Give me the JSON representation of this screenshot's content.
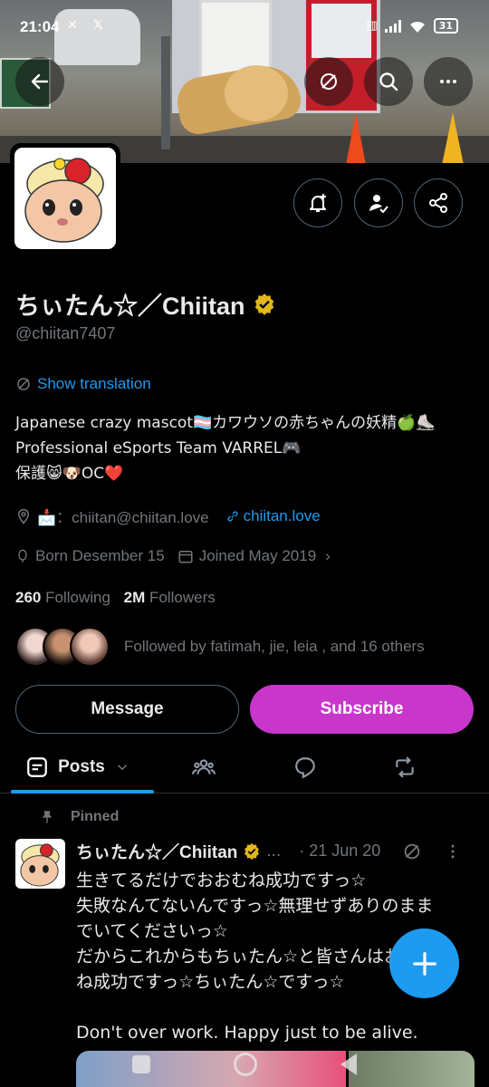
{
  "status_bar": {
    "time": "21:04",
    "notification_icons": "✕ 𝕏",
    "battery": "31"
  },
  "profile": {
    "display_name": "ちぃたん☆／Chiitan",
    "handle": "@chiitan7407",
    "show_translation": "Show translation",
    "bio_lines": [
      "Japanese crazy mascot🏳️‍⚧️カワウソの赤ちゃんの妖精🍏⛸️",
      "Professional eSports Team VARREL🎮",
      "保護😸🐶OC❤️"
    ],
    "location": "📩：chiitan@chiitan.love",
    "website": "chiitan.love",
    "birthday": "Born Desember 15",
    "joined": "Joined May 2019",
    "following_count": "260",
    "following_label": "Following",
    "followers_count": "2M",
    "followers_label": "Followers",
    "followed_by": "Followed by fatimah, jie, leia , and 16 others"
  },
  "buttons": {
    "message": "Message",
    "subscribe": "Subscribe"
  },
  "tabs": {
    "posts": "Posts"
  },
  "post": {
    "pinned_label": "Pinned",
    "author": "ちぃたん☆／Chiitan",
    "ellipsis": "...",
    "date": "· 21 Jun 20",
    "body_lines": [
      "生きてるだけでおおむね成功ですっ☆",
      "失敗なんてないんですっ☆無理せずありのまま",
      "でいてくださいっ☆",
      "だからこれからもちぃたん☆と皆さんはおおむ",
      "ね成功ですっ☆ちぃたん☆ですっ☆",
      "",
      "Don't over work. Happy just to be alive."
    ]
  },
  "colors": {
    "accent": "#1d9bf0",
    "subscribe": "#c936cc",
    "verified": "#e2b719",
    "muted": "#71767b"
  }
}
